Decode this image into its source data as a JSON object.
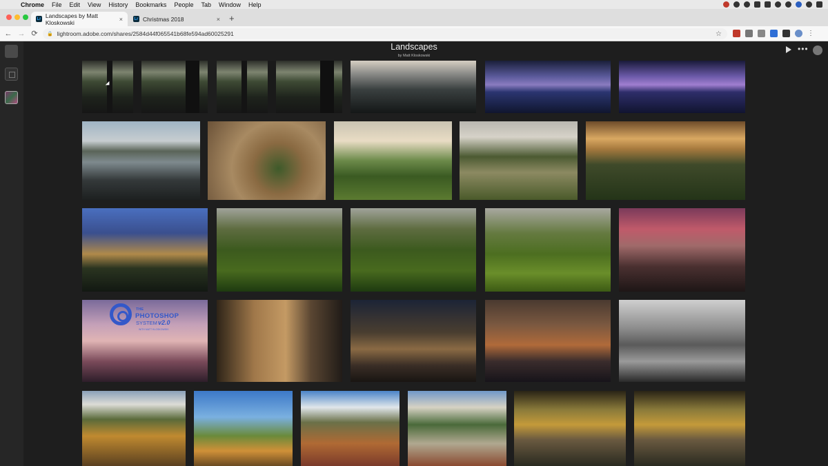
{
  "menubar": {
    "app": "Chrome",
    "items": [
      "File",
      "Edit",
      "View",
      "History",
      "Bookmarks",
      "People",
      "Tab",
      "Window",
      "Help"
    ]
  },
  "tabs": [
    {
      "label": "Landscapes by Matt Kloskowski",
      "favicon": "Lr",
      "active": true
    },
    {
      "label": "Christmas 2018",
      "favicon": "Lr",
      "active": false
    }
  ],
  "toolbar": {
    "url": "lightroom.adobe.com/shares/2584d44f065541b68fe594ad60025291"
  },
  "gallery": {
    "title": "Landscapes",
    "subtitle": "by Matt Kloskowski"
  },
  "overlay": {
    "the": "THE",
    "brand": "PHOTOSHOP",
    "system": "SYSTEM",
    "version": "v2.0",
    "byline": "WITH MATT KLOSKOWSKI"
  },
  "icons": {
    "apple": "apple-icon",
    "back": "back-arrow-icon",
    "forward": "forward-arrow-icon",
    "reload": "reload-icon",
    "lock": "lock-icon",
    "star": "bookmark-star-icon",
    "play": "play-icon",
    "more": "more-icon",
    "user": "user-icon"
  },
  "glyphs": {
    "apple": "",
    "close": "×",
    "newtab": "+",
    "back": "←",
    "forward": "→",
    "reload": "⟳",
    "lock": "🔒",
    "star": "☆",
    "more": "•••",
    "chrome_menu": "⋮"
  },
  "colors": {
    "background": "#1e1e1e",
    "rail": "#262626"
  }
}
